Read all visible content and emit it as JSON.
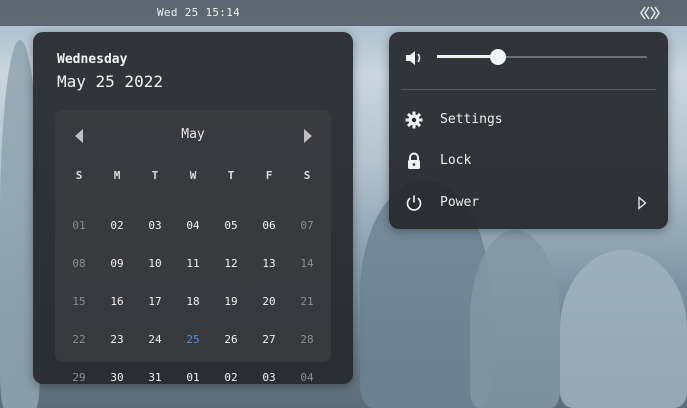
{
  "topbar": {
    "clock": "Wed 25 15:14",
    "icon": "network-icon"
  },
  "calendar": {
    "weekday": "Wednesday",
    "full_date": "May 25 2022",
    "month": "May",
    "day_headers": [
      "S",
      "M",
      "T",
      "W",
      "T",
      "F",
      "S"
    ],
    "weeks": [
      [
        {
          "d": "01",
          "m": "other"
        },
        {
          "d": "02",
          "m": "current"
        },
        {
          "d": "03",
          "m": "current"
        },
        {
          "d": "04",
          "m": "current"
        },
        {
          "d": "05",
          "m": "current"
        },
        {
          "d": "06",
          "m": "current"
        },
        {
          "d": "07",
          "m": "other"
        }
      ],
      [
        {
          "d": "08",
          "m": "other"
        },
        {
          "d": "09",
          "m": "current"
        },
        {
          "d": "10",
          "m": "current"
        },
        {
          "d": "11",
          "m": "current"
        },
        {
          "d": "12",
          "m": "current"
        },
        {
          "d": "13",
          "m": "current"
        },
        {
          "d": "14",
          "m": "other"
        }
      ],
      [
        {
          "d": "15",
          "m": "other"
        },
        {
          "d": "16",
          "m": "current"
        },
        {
          "d": "17",
          "m": "current"
        },
        {
          "d": "18",
          "m": "current"
        },
        {
          "d": "19",
          "m": "current"
        },
        {
          "d": "20",
          "m": "current"
        },
        {
          "d": "21",
          "m": "other"
        }
      ],
      [
        {
          "d": "22",
          "m": "other"
        },
        {
          "d": "23",
          "m": "current"
        },
        {
          "d": "24",
          "m": "current"
        },
        {
          "d": "25",
          "m": "today"
        },
        {
          "d": "26",
          "m": "current"
        },
        {
          "d": "27",
          "m": "current"
        },
        {
          "d": "28",
          "m": "other"
        }
      ],
      [
        {
          "d": "29",
          "m": "other"
        },
        {
          "d": "30",
          "m": "current"
        },
        {
          "d": "31",
          "m": "current"
        },
        {
          "d": "01",
          "m": "current"
        },
        {
          "d": "02",
          "m": "current"
        },
        {
          "d": "03",
          "m": "current"
        },
        {
          "d": "04",
          "m": "other"
        }
      ]
    ]
  },
  "system_menu": {
    "volume_fraction": 0.29,
    "items": [
      {
        "label": "Settings",
        "icon": "gear-icon"
      },
      {
        "label": "Lock",
        "icon": "lock-icon"
      },
      {
        "label": "Power",
        "icon": "power-icon"
      }
    ]
  },
  "colors": {
    "today": "#4c8fe6",
    "panel_bg": "#26282c"
  }
}
